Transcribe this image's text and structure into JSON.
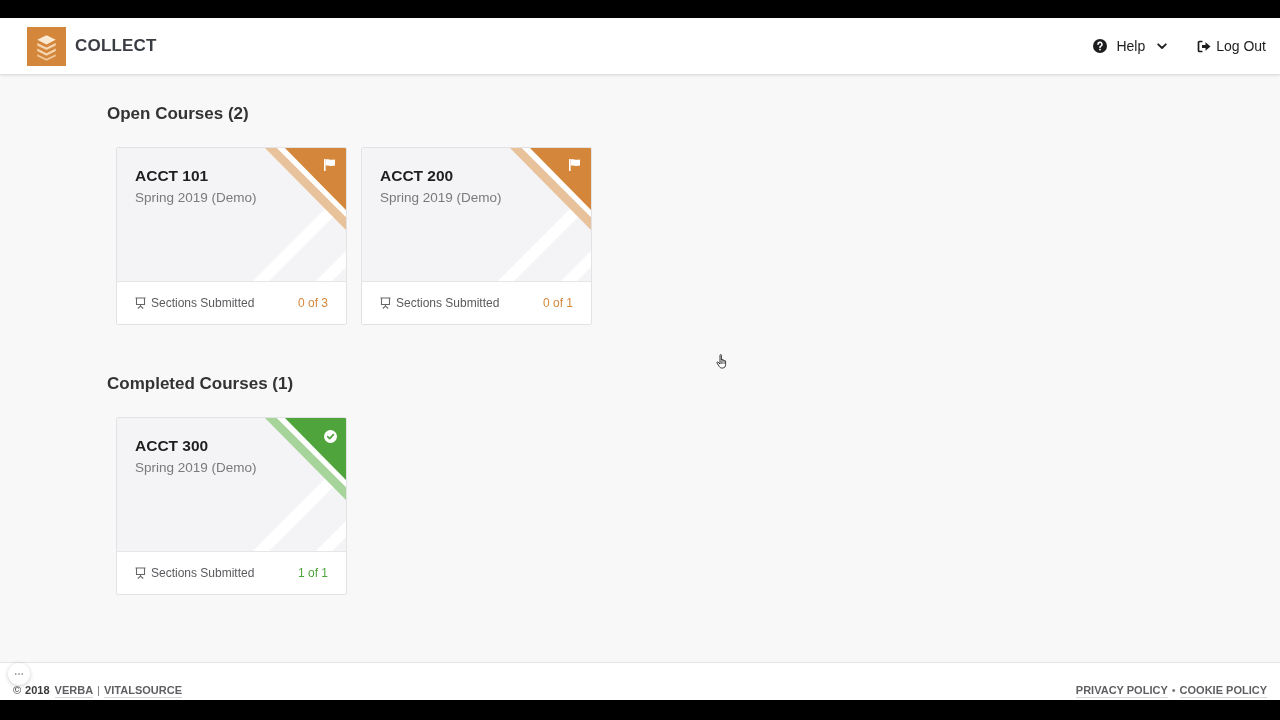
{
  "header": {
    "brand": "COLLECT",
    "help_menu": {
      "label": "Help"
    },
    "logout": {
      "label": "Log Out"
    }
  },
  "sections": [
    {
      "title": "Open Courses (2)",
      "courses": [
        {
          "code": "ACCT 101",
          "term": "Spring 2019 (Demo)",
          "completed": false,
          "progress_label": "Sections Submitted",
          "progress": "0 of 3"
        },
        {
          "code": "ACCT 200",
          "term": "Spring 2019 (Demo)",
          "completed": false,
          "progress_label": "Sections Submitted",
          "progress": "0 of 1"
        }
      ]
    },
    {
      "title": "Completed Courses (1)",
      "courses": [
        {
          "code": "ACCT 300",
          "term": "Spring 2019 (Demo)",
          "completed": true,
          "progress_label": "Sections Submitted",
          "progress": "1 of 1"
        }
      ]
    }
  ],
  "footer": {
    "copyright": "©",
    "year": "2018",
    "brand_links": [
      {
        "label": "VERBA"
      },
      {
        "label": "VITALSOURCE"
      }
    ],
    "brand_separator": "|",
    "policy_links": [
      {
        "label": "PRIVACY POLICY"
      },
      {
        "label": "COOKIE POLICY"
      }
    ],
    "policy_separator": "•"
  }
}
